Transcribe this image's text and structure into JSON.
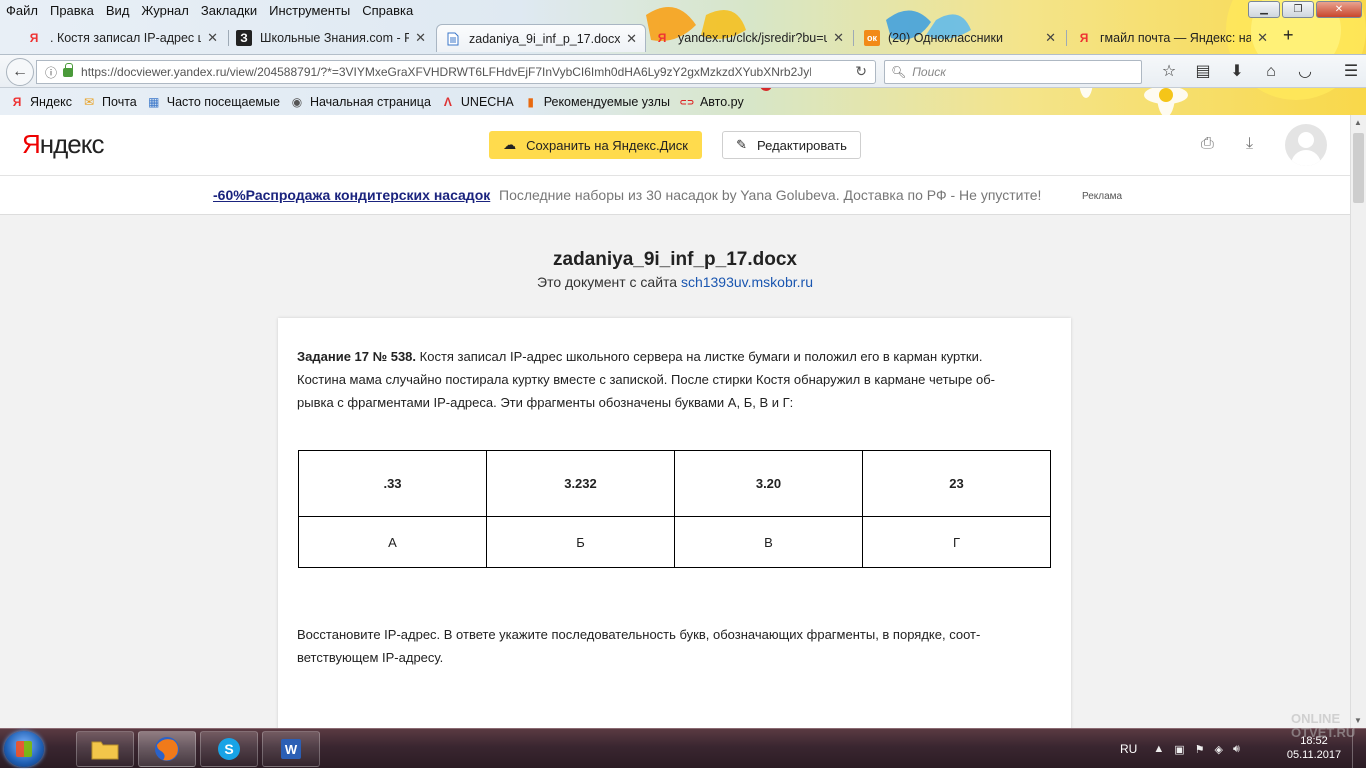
{
  "browser": {
    "menu": [
      "Файл",
      "Правка",
      "Вид",
      "Журнал",
      "Закладки",
      "Инструменты",
      "Справка"
    ],
    "window_controls": {
      "minimize": "▁",
      "maximize": "❐",
      "close": "✕"
    },
    "tabs": [
      {
        "title": ". Костя записал IP-адрес шк",
        "favicon": "Я",
        "icon_color": "#e33"
      },
      {
        "title": "Школьные Знания.com - Ре",
        "favicon": "З",
        "icon_color": "#222"
      },
      {
        "title": "zadaniya_9i_inf_p_17.docx",
        "favicon": "doc-icon",
        "icon_color": "#3b77c9",
        "active": true
      },
      {
        "title": "yandex.ru/clck/jsredir?bu=u",
        "favicon": "Я",
        "icon_color": "#e33"
      },
      {
        "title": "(20) Одноклассники",
        "favicon": "ок",
        "icon_color": "#f28a18"
      },
      {
        "title": "гмайл почта — Яндекс: на",
        "favicon": "Я",
        "icon_color": "#e33"
      }
    ],
    "new_tab": "+",
    "url": "https://docviewer.yandex.ru/view/204588791/?*=3VIYMxeGraXFVHDRWT6LFHdvEjF7InVybCI6Imh0dHA6Ly9zY2gxMzkzdXYubXNrb2JyLnJ1",
    "search_placeholder": "Поиск",
    "bookmarks": [
      {
        "label": "Яндекс",
        "icon": "Я",
        "color": "#e33"
      },
      {
        "label": "Почта",
        "icon": "✉",
        "color": "#e8a020"
      },
      {
        "label": "Часто посещаемые",
        "icon": "▦",
        "color": "#3b77c9"
      },
      {
        "label": "Начальная страница",
        "icon": "◉",
        "color": "#555"
      },
      {
        "label": "UNECHA",
        "icon": "Λ",
        "color": "#d33"
      },
      {
        "label": "Рекомендуемые узлы",
        "icon": "▮",
        "color": "#e86a10"
      },
      {
        "label": "Авто.ру",
        "icon": "⊂⊃",
        "color": "#d22"
      }
    ]
  },
  "yandex": {
    "logo_first": "Я",
    "logo_rest": "ндекс",
    "save_label": "Сохранить на Яндекс.Диск",
    "edit_label": "Редактировать"
  },
  "ad": {
    "link": "-60%Распродажа кондитерских насадок",
    "text": "Последние наборы из 30 насадок by Yana Golubeva. Доставка по РФ - Не упустите!",
    "label": "Реклама"
  },
  "document": {
    "title": "zadaniya_9i_inf_p_17.docx",
    "source_prefix": "Это документ с сайта ",
    "source_link": "sch1393uv.mskobr.ru",
    "task_label": "Задание 17 № 538.",
    "task_line1": " Костя записал IP-адрес школьного сервера на листке бумаги и положил его в карман куртки.",
    "task_line2": "Костина мама случайно постирала куртку вместе с запиской. После стирки Костя обнаружил в кармане четыре об-",
    "task_line3": "рывка с фрагментами IP-адреса. Эти фрагменты обозначены буквами А, Б, В и Г:",
    "fragments": [
      ".33",
      "3.232",
      "3.20",
      "23"
    ],
    "letters": [
      "А",
      "Б",
      "В",
      "Г"
    ],
    "question_line1": "Восстановите IP-адрес. В ответе укажите последовательность букв, обозначающих фрагменты, в порядке, соот-",
    "question_line2": "ветствующем IP-адресу."
  },
  "taskbar": {
    "lang": "RU",
    "time": "18:52",
    "date": "05.11.2017"
  },
  "watermark": {
    "line1": "ONLINE",
    "line2": "OTVET.RU"
  }
}
